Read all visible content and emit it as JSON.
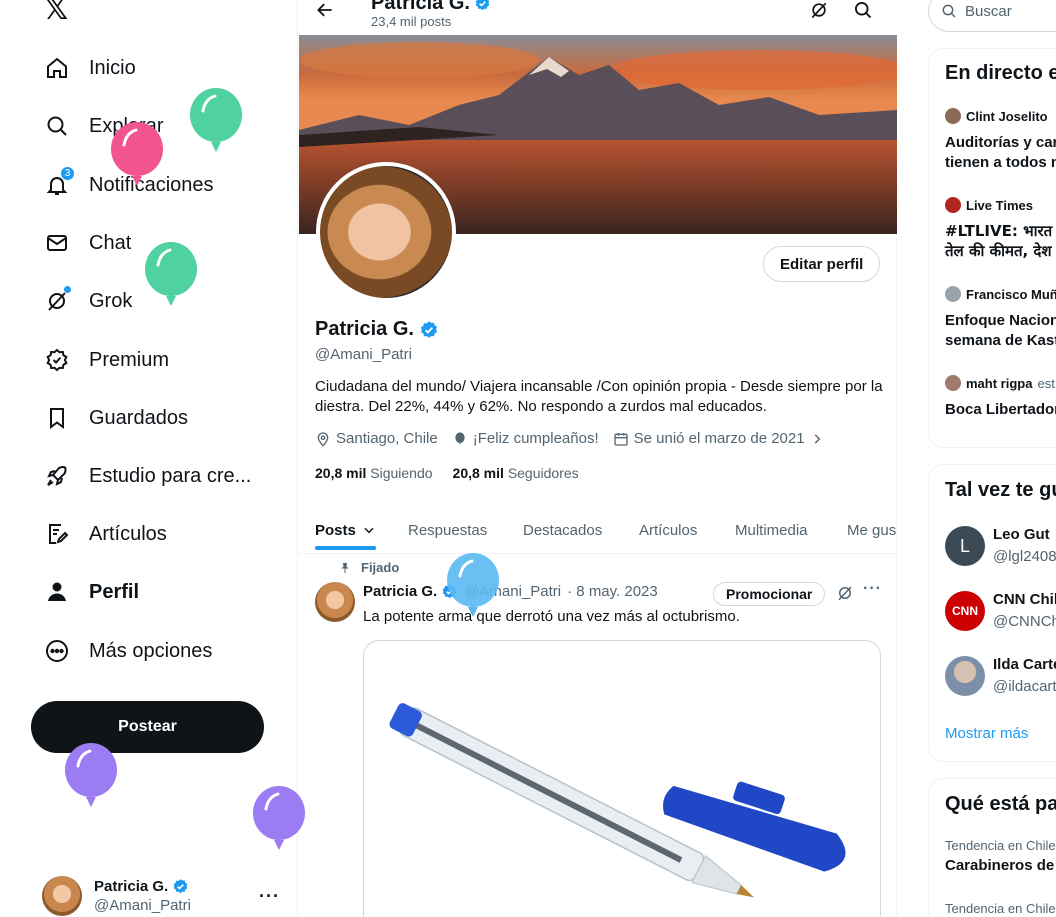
{
  "left_nav": {
    "logo": "𝕏",
    "items": [
      {
        "label": "Inicio",
        "icon": "home-icon"
      },
      {
        "label": "Explorar",
        "icon": "search-icon"
      },
      {
        "label": "Notificaciones",
        "icon": "bell-icon",
        "badge": "3"
      },
      {
        "label": "Chat",
        "icon": "mail-icon"
      },
      {
        "label": "Grok",
        "icon": "grok-icon"
      },
      {
        "label": "Premium",
        "icon": "premium-icon"
      },
      {
        "label": "Guardados",
        "icon": "bookmark-icon"
      },
      {
        "label": "Estudio para cre...",
        "icon": "rocket-icon"
      },
      {
        "label": "Artículos",
        "icon": "article-icon"
      },
      {
        "label": "Perfil",
        "icon": "person-icon"
      },
      {
        "label": "Más opciones",
        "icon": "more-circle-icon"
      }
    ],
    "post_button": "Postear",
    "account": {
      "name": "Patricia G.",
      "handle": "@Amani_Patri",
      "more": "···"
    }
  },
  "header": {
    "name": "Patricia G.",
    "posts_count": "23,4 mil posts"
  },
  "profile": {
    "edit_button": "Editar perfil",
    "name": "Patricia G.",
    "handle": "@Amani_Patri",
    "bio": "Ciudadana del mundo/ Viajera incansable /Con opinión propia -  Desde siempre por la diestra. Del 22%, 44%  y 62%.  No respondo a zurdos mal educados.",
    "location": "Santiago, Chile",
    "birthday": "¡Feliz cumpleaños!",
    "joined": "Se unió el marzo de 2021",
    "following_count": "20,8 mil",
    "following_label": "Siguiendo",
    "followers_count": "20,8 mil",
    "followers_label": "Seguidores"
  },
  "tabs": [
    {
      "label": "Posts",
      "active": true
    },
    {
      "label": "Respuestas"
    },
    {
      "label": "Destacados"
    },
    {
      "label": "Artículos"
    },
    {
      "label": "Multimedia"
    },
    {
      "label": "Me gus"
    }
  ],
  "tweet": {
    "pinned_label": "Fijado",
    "author": "Patricia G.",
    "handle": "@Amani_Patri",
    "date": "· 8 may. 2023",
    "promote_button": "Promocionar",
    "text": "La potente arma que derrotó una vez más al octubrismo.",
    "more": "···"
  },
  "right": {
    "search_placeholder": "Buscar",
    "live": {
      "title": "En directo e",
      "items": [
        {
          "user": "Clint Joselito",
          "text1": "Auditorías y car",
          "text2": "tienen a todos n"
        },
        {
          "user": "Live Times",
          "text1": "#LTLIVE: भारत मे",
          "text2": "तेल की कीमत, देश"
        },
        {
          "user": "Francisco Muñ",
          "text1": "Enfoque Nacion",
          "text2": "semana de Kast"
        },
        {
          "user": "maht rigpa",
          "user_suffix": "est",
          "text1": "Boca Libertador"
        }
      ]
    },
    "suggestions": {
      "title": "Tal vez te gu",
      "items": [
        {
          "name": "Leo Gut",
          "handle": "@lgl2408",
          "initial": "L"
        },
        {
          "name": "CNN Chil",
          "handle": "@CNNCh",
          "initial": "CNN"
        },
        {
          "name": "Ilda Carte",
          "handle": "@ildacart",
          "initial": ""
        }
      ],
      "show_more": "Mostrar más"
    },
    "trends": {
      "title": "Qué está pa",
      "items": [
        {
          "context": "Tendencia en Chile",
          "name": "Carabineros de"
        },
        {
          "context": "Tendencia en Chile",
          "name": ""
        }
      ]
    }
  },
  "colors": {
    "accent": "#1d9bf0",
    "text": "#0f1419",
    "muted": "#536471"
  }
}
